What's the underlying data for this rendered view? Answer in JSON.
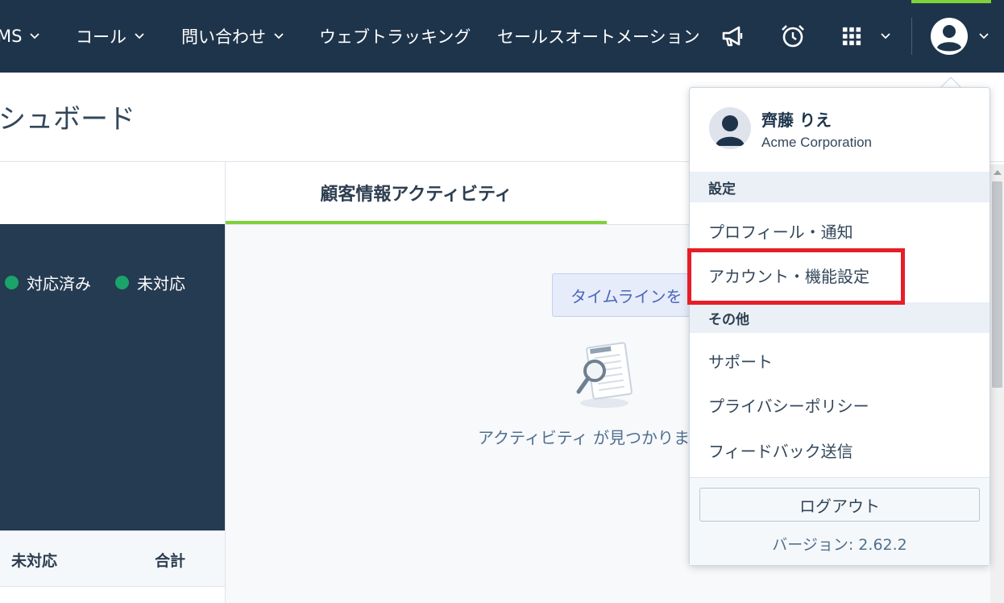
{
  "nav": {
    "items": [
      {
        "label": "MS"
      },
      {
        "label": "コール"
      },
      {
        "label": "問い合わせ"
      },
      {
        "label": "ウェブトラッキング"
      },
      {
        "label": "セールスオートメーション"
      }
    ],
    "icons": [
      "megaphone-icon",
      "alarm-clock-icon",
      "apps-grid-icon",
      "user-avatar-icon"
    ]
  },
  "page": {
    "title": "ダッシュボード"
  },
  "legend": [
    {
      "label": "対応済み",
      "color": "#1aa36b"
    },
    {
      "label": "未対応",
      "color": "#1aa36b"
    }
  ],
  "table": {
    "headers": [
      "未対応",
      "合計"
    ]
  },
  "activity": {
    "tab_label": "顧客情報アクティビティ",
    "timeline_button": "タイムラインを",
    "empty_text": "アクティビティ が見つかりま"
  },
  "user_menu": {
    "name": "齊藤 りえ",
    "company": "Acme Corporation",
    "section_settings": "設定",
    "settings_items": [
      "プロフィール・通知",
      "アカウント・機能設定"
    ],
    "section_other": "その他",
    "other_items": [
      "サポート",
      "プライバシーポリシー",
      "フィードバック送信"
    ],
    "logout": "ログアウト",
    "version": "バージョン: 2.62.2"
  },
  "colors": {
    "nav_bg": "#1e344b",
    "accent_green": "#7fd13b",
    "highlight_red": "#e61e28"
  }
}
